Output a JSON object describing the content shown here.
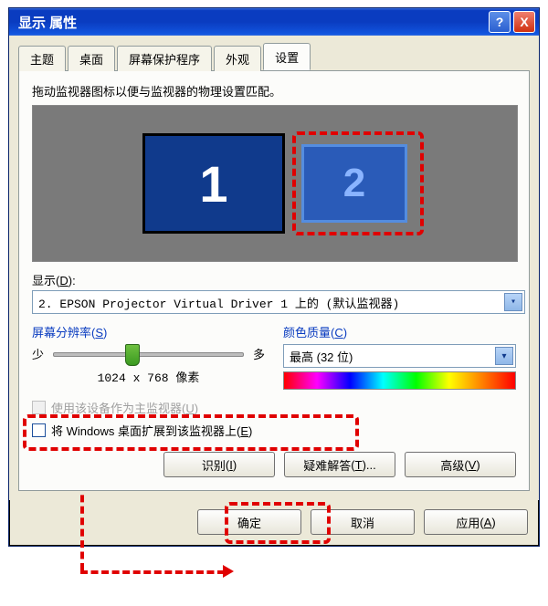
{
  "titlebar": {
    "title": "显示 属性",
    "help": "?",
    "close": "X"
  },
  "tabs": {
    "items": [
      {
        "label": "主题"
      },
      {
        "label": "桌面"
      },
      {
        "label": "屏幕保护程序"
      },
      {
        "label": "外观"
      },
      {
        "label": "设置"
      }
    ],
    "active_index": 4
  },
  "settings": {
    "instruction": "拖动监视器图标以便与监视器的物理设置匹配。",
    "monitor1": "1",
    "monitor2": "2",
    "display_label": "显示",
    "display_hotkey": "D",
    "display_value": "2. EPSON Projector Virtual Driver 1 上的 (默认监视器)",
    "resolution": {
      "title": "屏幕分辨率",
      "title_hotkey": "S",
      "less": "少",
      "more": "多",
      "value_text": "1024 x 768 像素"
    },
    "color": {
      "title": "颜色质量",
      "title_hotkey": "C",
      "value": "最高 (32 位)"
    },
    "primary_check": {
      "label": "使用该设备作为主监视器",
      "hotkey": "U"
    },
    "extend_check": {
      "label_pre": "将 Windows 桌面扩展到该监视器上",
      "hotkey": "E"
    },
    "buttons": {
      "identify": "识别",
      "identify_hotkey": "I",
      "troubleshoot": "疑难解答",
      "troubleshoot_hotkey": "T",
      "advanced": "高级",
      "advanced_hotkey": "V"
    }
  },
  "dialog_buttons": {
    "ok": "确定",
    "cancel": "取消",
    "apply": "应用",
    "apply_hotkey": "A"
  }
}
